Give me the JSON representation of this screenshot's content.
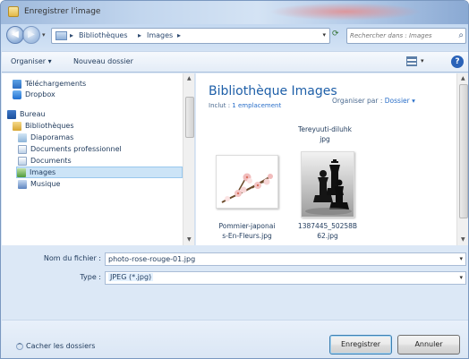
{
  "window": {
    "title": "Enregistrer l'image"
  },
  "navigation": {
    "breadcrumbs": [
      "Bibliothèques",
      "Images"
    ],
    "search_placeholder": "Rechercher dans : Images"
  },
  "toolbar": {
    "organize_label": "Organiser ▾",
    "new_folder_label": "Nouveau dossier"
  },
  "nav_pane": {
    "items": [
      {
        "label": "Téléchargements",
        "icon": "download-folder-icon"
      },
      {
        "label": "Dropbox",
        "icon": "dropbox-icon"
      },
      {
        "label": "Bureau",
        "icon": "desktop-icon"
      },
      {
        "label": "Bibliothèques",
        "icon": "libraries-icon"
      },
      {
        "label": "Diaporamas",
        "icon": "slideshow-icon"
      },
      {
        "label": "Documents professionnel",
        "icon": "document-folder-icon"
      },
      {
        "label": "Documents",
        "icon": "documents-icon"
      },
      {
        "label": "Images",
        "icon": "images-icon",
        "selected": true
      },
      {
        "label": "Musique",
        "icon": "music-icon"
      }
    ]
  },
  "content": {
    "library_title": "Bibliothèque Images",
    "include_prefix": "Inclut : ",
    "include_link": "1 emplacement",
    "arrange_prefix": "Organiser par : ",
    "arrange_value": "Dossier ▾",
    "files": [
      {
        "name_line1": "Tereyuuti-diluhk",
        "name_line2": "jpg"
      },
      {
        "name_line1": "Pommier-japonai",
        "name_line2": "s-En-Fleurs.jpg"
      },
      {
        "name_line1": "1387445_50258B",
        "name_line2": "62.jpg"
      }
    ]
  },
  "form": {
    "filename_label": "Nom du fichier :",
    "filename_value": "photo-rose-rouge-01.jpg",
    "type_label": "Type :",
    "type_value": "JPEG (*.jpg)"
  },
  "footer": {
    "hide_folders_label": "Cacher les dossiers",
    "save_label": "Enregistrer",
    "cancel_label": "Annuler"
  },
  "colors": {
    "accent": "#1e5fa8",
    "selection": "#cce4f7"
  }
}
